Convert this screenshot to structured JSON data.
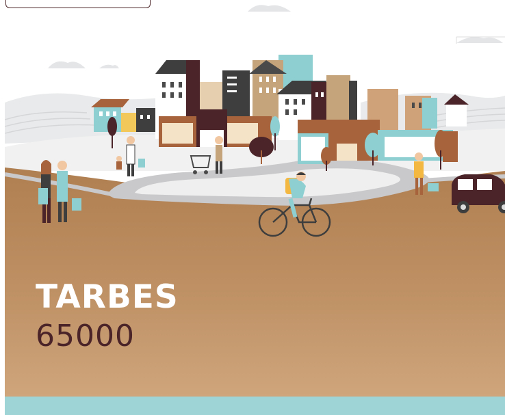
{
  "location": {
    "city": "TARBES",
    "postal_code": "65000"
  },
  "colors": {
    "ground": "#b8875a",
    "text_primary": "#ffffff",
    "text_secondary": "#4a2428",
    "accent_band": "#9fd4d6",
    "dark_red": "#4a2428",
    "teal": "#8ecfd2"
  },
  "illustration": {
    "subject": "town-scene",
    "elements": [
      "buildings",
      "trees",
      "shoppers",
      "cyclist",
      "car",
      "road"
    ]
  }
}
